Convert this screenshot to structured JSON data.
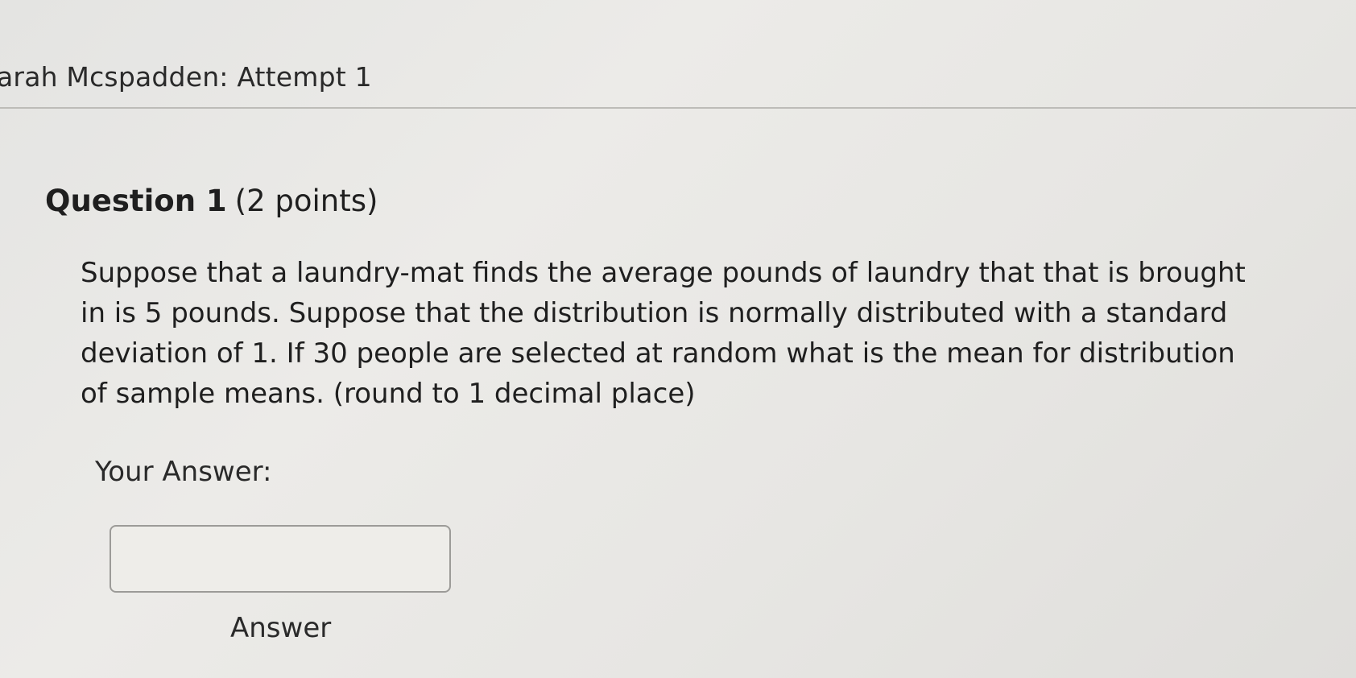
{
  "header": {
    "title": "arah Mcspadden: Attempt 1"
  },
  "question": {
    "number_label": "Question 1",
    "points_label": "(2 points)",
    "body_lines": [
      "Suppose that a laundry-mat finds the average pounds of laundry that that is brought",
      "in is 5 pounds. Suppose that the distribution is normally distributed with a standard",
      "deviation of 1. If 30 people are selected at random what is the mean for distribution",
      "of sample means.  (round to 1 decimal place)"
    ]
  },
  "answer": {
    "label": "Your Answer:",
    "input_value": "",
    "caption": "Answer"
  }
}
